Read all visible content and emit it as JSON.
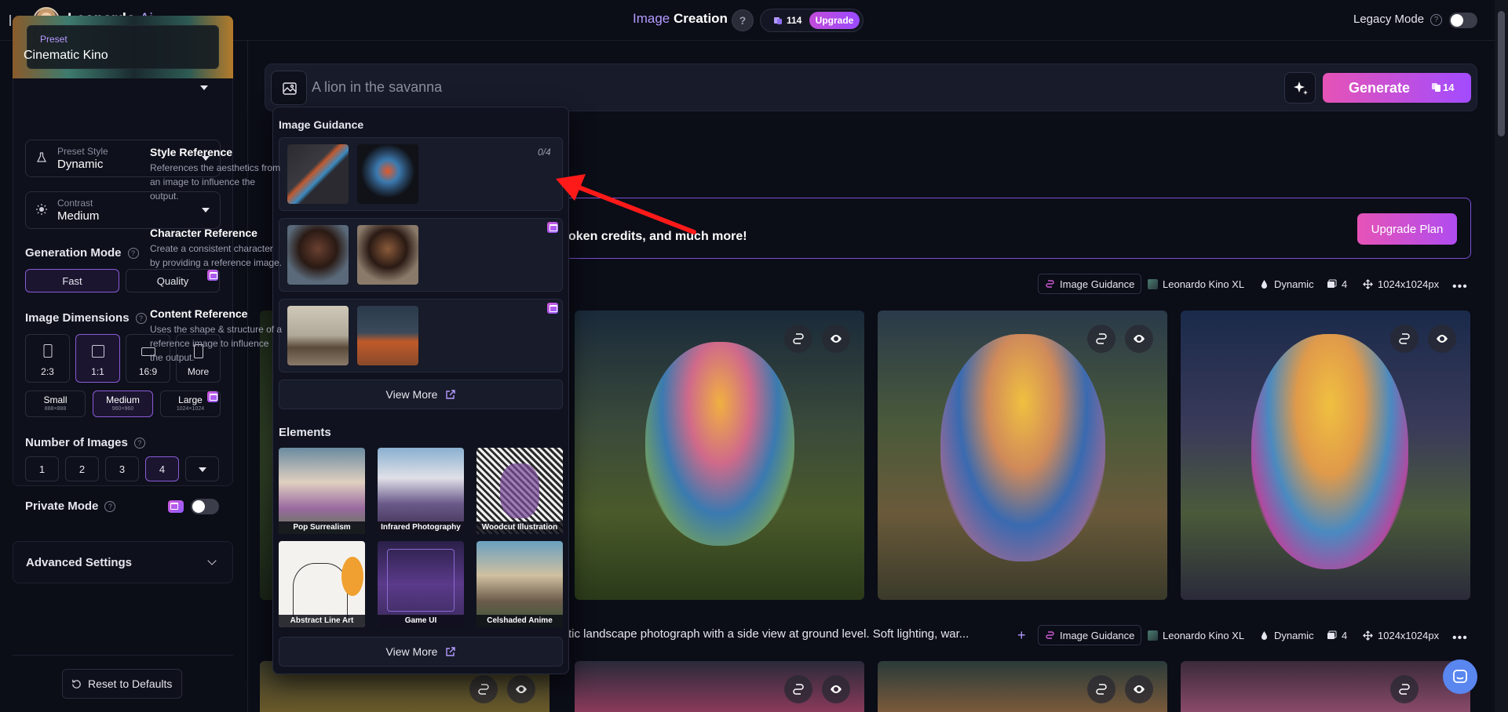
{
  "topbar": {
    "brand_name": "Leonardo",
    "brand_suffix": ".Ai",
    "nav_image": "Image",
    "nav_creation": "Creation",
    "help": "?",
    "credits": "114",
    "upgrade": "Upgrade",
    "legacy_mode": "Legacy Mode",
    "legacy_help": "?"
  },
  "sidebar": {
    "preset_label": "Preset",
    "preset_value": "Cinematic Kino",
    "preset_style_label": "Preset Style",
    "preset_style_value": "Dynamic",
    "contrast_label": "Contrast",
    "contrast_value": "Medium",
    "generation_mode_title": "Generation Mode",
    "generation_modes": [
      "Fast",
      "Quality"
    ],
    "image_dimensions_title": "Image Dimensions",
    "ratios": [
      "2:3",
      "1:1",
      "16:9",
      "More"
    ],
    "sizes": [
      {
        "label": "Small",
        "dims": "888×888"
      },
      {
        "label": "Medium",
        "dims": "960×960"
      },
      {
        "label": "Large",
        "dims": "1024×1024"
      }
    ],
    "number_of_images_title": "Number of Images",
    "numbers": [
      "1",
      "2",
      "3",
      "4"
    ],
    "private_mode": "Private Mode",
    "advanced_settings": "Advanced Settings",
    "reset": "Reset to Defaults"
  },
  "prompt": {
    "placeholder": "A lion in the savanna",
    "generate": "Generate",
    "generate_cost": "14"
  },
  "banner": {
    "text": "oken credits, and much more!",
    "upgrade_plan": "Upgrade Plan"
  },
  "generations": [
    {
      "meta": [
        "Image Guidance",
        "Leonardo Kino XL",
        "Dynamic",
        "4",
        "1024x1024px"
      ]
    },
    {
      "prompt": "tic landscape photograph with a side view at ground level. Soft lighting, war...",
      "meta": [
        "Image Guidance",
        "Leonardo Kino XL",
        "Dynamic",
        "4",
        "1024x1024px"
      ]
    }
  ],
  "guidance_panel": {
    "title": "Image Guidance",
    "refs": [
      {
        "name": "Style Reference",
        "count": "0/4",
        "desc": "References the aesthetics from an image to influence the output."
      },
      {
        "name": "Character Reference",
        "desc": "Create a consistent character by providing a reference image."
      },
      {
        "name": "Content Reference",
        "desc": "Uses the shape & structure of a reference image to influence the output."
      }
    ],
    "view_more": "View More",
    "elements_title": "Elements",
    "elements": [
      "Pop Surrealism",
      "Infrared Photography",
      "Woodcut Illustration",
      "Abstract Line Art",
      "Game UI",
      "Celshaded Anime"
    ],
    "elements_view_more": "View More"
  },
  "colors": {
    "accent": "#b49bff",
    "gradient_start": "#e653b6",
    "gradient_end": "#a24cff",
    "background": "#0b0d17"
  }
}
